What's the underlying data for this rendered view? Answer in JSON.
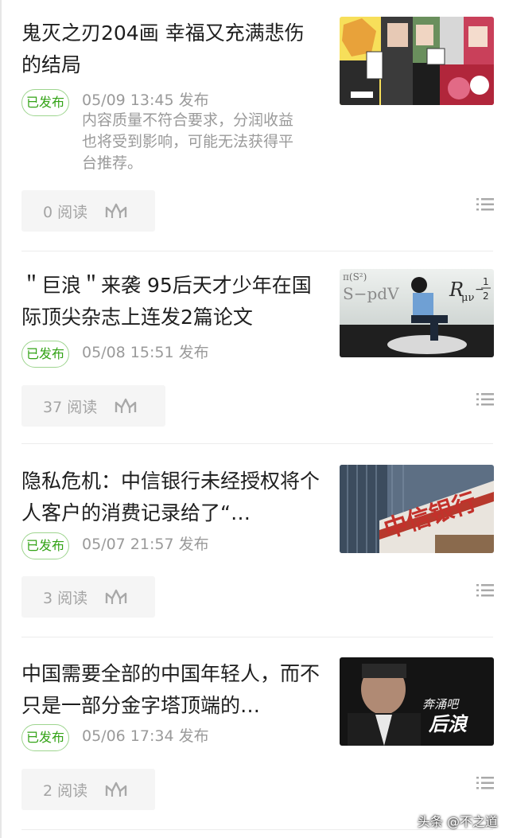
{
  "articles": [
    {
      "title": "鬼灭之刃204画 幸福又充满悲伤的结局",
      "badge": "已发布",
      "published": "05/09 13:45 发布",
      "warning": "内容质量不符合要求，分润收益也将受到影响，可能无法获得平台推荐。",
      "reads": "0 阅读"
    },
    {
      "title": "＂巨浪＂来袭 95后天才少年在国际顶尖杂志上连发2篇论文",
      "badge": "已发布",
      "published": "05/08 15:51 发布",
      "reads": "37 阅读"
    },
    {
      "title": "隐私危机：中信银行未经授权将个人客户的消费记录给了“…",
      "badge": "已发布",
      "published": "05/07 21:57 发布",
      "thumb_text": "中信银行",
      "reads": "3 阅读"
    },
    {
      "title": "中国需要全部的中国年轻人，而不只是一部分金字塔顶端的…",
      "badge": "已发布",
      "published": "05/06 17:34 发布",
      "thumb_text_1": "奔涌吧",
      "thumb_text_2": "后浪",
      "reads": "2 阅读"
    }
  ],
  "watermark": "头条 @不之道",
  "colors": {
    "badge_green": "#33a316",
    "badge_border": "#9ed58f",
    "meta_gray": "#9a9a9a",
    "stats_bg": "#f5f5f5"
  },
  "icons": {
    "stats": "trend-chart-icon",
    "more": "list-menu-icon"
  }
}
